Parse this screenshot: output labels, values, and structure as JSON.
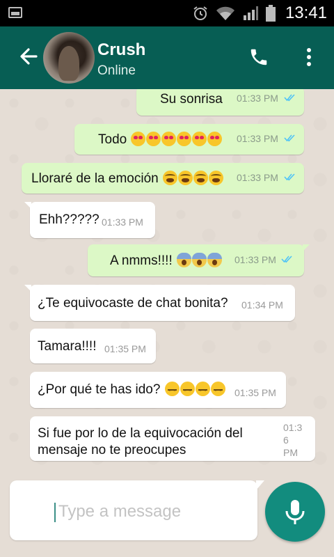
{
  "status_bar": {
    "time": "13:41"
  },
  "header": {
    "contact_name": "Crush",
    "contact_status": "Online"
  },
  "messages": [
    {
      "dir": "out",
      "text": "Su sonrisa",
      "time": "01:33 PM"
    },
    {
      "dir": "out",
      "text": "Todo",
      "emojis": [
        "love",
        "love",
        "love",
        "love",
        "love",
        "love"
      ],
      "time": "01:33 PM"
    },
    {
      "dir": "out",
      "text": "Lloraré de la emoción",
      "emojis": [
        "cry",
        "cry",
        "cry",
        "cry"
      ],
      "time": "01:33 PM"
    },
    {
      "dir": "in",
      "text": "Ehh?????",
      "time": "01:33 PM"
    },
    {
      "dir": "out",
      "text": "A nmms!!!!",
      "emojis": [
        "scream",
        "scream",
        "scream"
      ],
      "time": "01:33 PM"
    },
    {
      "dir": "in",
      "text": "¿Te equivocaste de chat bonita?",
      "time": "01:34 PM"
    },
    {
      "dir": "in",
      "text": "Tamara!!!!",
      "time": "01:35 PM"
    },
    {
      "dir": "in",
      "text": "¿Por qué te has ido?",
      "emojis": [
        "sad",
        "sad",
        "sad",
        "sad"
      ],
      "time": "01:35 PM"
    },
    {
      "dir": "in",
      "text_line1": "Si fue por lo de la equivocación del",
      "text_line2": "mensaje no te preocupes",
      "time_line1": "01:3",
      "time_line2": "6",
      "time_line3": "PM"
    }
  ],
  "composer": {
    "placeholder": "Type a message"
  },
  "icons": {
    "back": "arrow-left-icon",
    "call": "phone-icon",
    "menu": "more-vert-icon",
    "mic": "microphone-icon",
    "read": "double-check-icon"
  },
  "colors": {
    "header": "#075e54",
    "outgoing": "#dcf8c6",
    "incoming": "#ffffff",
    "read_ticks": "#4fc3f7",
    "mic_button": "#128c7e",
    "chat_bg": "#e5ddd5"
  }
}
